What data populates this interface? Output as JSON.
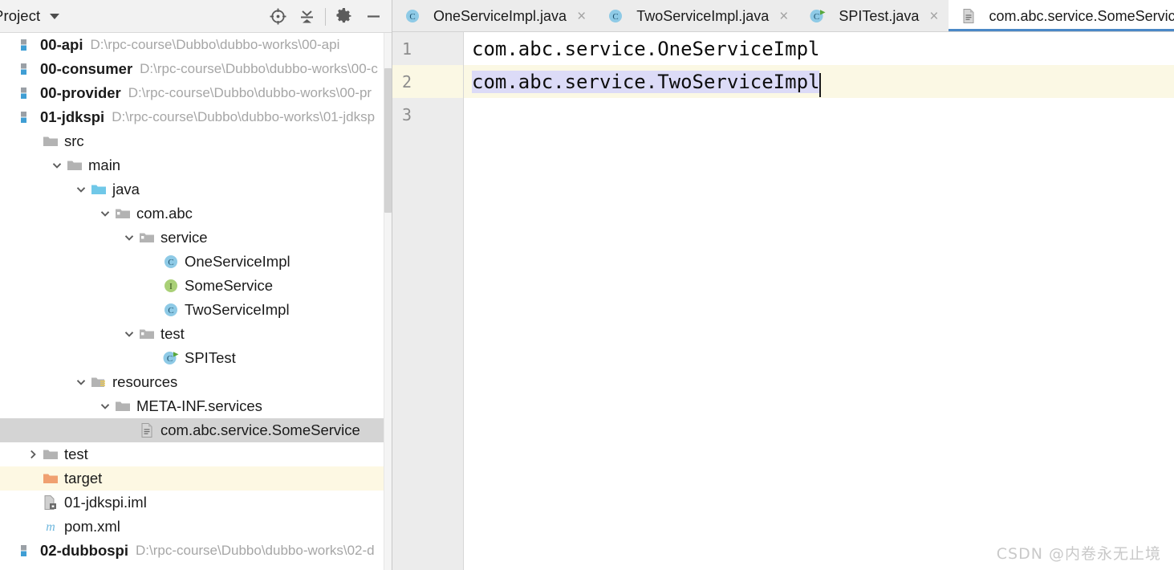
{
  "panel": {
    "title": "Project",
    "dropdown_icon": "chevron-down-icon",
    "toolbar_buttons": [
      {
        "name": "locate-file-icon",
        "title": "Select Opened File"
      },
      {
        "name": "collapse-all-icon",
        "title": "Collapse All"
      },
      {
        "name": "gear-icon",
        "title": "Settings"
      },
      {
        "name": "minimize-icon",
        "title": "Hide"
      }
    ]
  },
  "tree": [
    {
      "label": "00-api",
      "path": "D:\\rpc-course\\Dubbo\\dubbo-works\\00-api",
      "icon": "module-icon",
      "indent": 0,
      "arrow": "none",
      "bold": true,
      "state": "normal"
    },
    {
      "label": "00-consumer",
      "path": "D:\\rpc-course\\Dubbo\\dubbo-works\\00-c",
      "icon": "module-icon",
      "indent": 0,
      "arrow": "none",
      "bold": true,
      "state": "normal"
    },
    {
      "label": "00-provider",
      "path": "D:\\rpc-course\\Dubbo\\dubbo-works\\00-pr",
      "icon": "module-icon",
      "indent": 0,
      "arrow": "none",
      "bold": true,
      "state": "normal"
    },
    {
      "label": "01-jdkspi",
      "path": "D:\\rpc-course\\Dubbo\\dubbo-works\\01-jdksp",
      "icon": "module-icon",
      "indent": 0,
      "arrow": "none",
      "bold": true,
      "state": "normal"
    },
    {
      "label": "src",
      "path": "",
      "icon": "folder-icon",
      "indent": 1,
      "arrow": "none",
      "bold": false,
      "state": "normal"
    },
    {
      "label": "main",
      "path": "",
      "icon": "folder-icon",
      "indent": 2,
      "arrow": "expanded",
      "bold": false,
      "state": "normal"
    },
    {
      "label": "java",
      "path": "",
      "icon": "source-folder-icon",
      "indent": 3,
      "arrow": "expanded",
      "bold": false,
      "state": "normal"
    },
    {
      "label": "com.abc",
      "path": "",
      "icon": "package-icon",
      "indent": 4,
      "arrow": "expanded",
      "bold": false,
      "state": "normal"
    },
    {
      "label": "service",
      "path": "",
      "icon": "package-icon",
      "indent": 5,
      "arrow": "expanded",
      "bold": false,
      "state": "normal"
    },
    {
      "label": "OneServiceImpl",
      "path": "",
      "icon": "java-class-icon",
      "indent": 6,
      "arrow": "none",
      "bold": false,
      "state": "normal"
    },
    {
      "label": "SomeService",
      "path": "",
      "icon": "java-interface-icon",
      "indent": 6,
      "arrow": "none",
      "bold": false,
      "state": "normal"
    },
    {
      "label": "TwoServiceImpl",
      "path": "",
      "icon": "java-class-icon",
      "indent": 6,
      "arrow": "none",
      "bold": false,
      "state": "normal"
    },
    {
      "label": "test",
      "path": "",
      "icon": "package-icon",
      "indent": 5,
      "arrow": "expanded",
      "bold": false,
      "state": "normal"
    },
    {
      "label": "SPITest",
      "path": "",
      "icon": "java-test-class-icon",
      "indent": 6,
      "arrow": "none",
      "bold": false,
      "state": "normal"
    },
    {
      "label": "resources",
      "path": "",
      "icon": "resources-folder-icon",
      "indent": 3,
      "arrow": "expanded",
      "bold": false,
      "state": "normal"
    },
    {
      "label": "META-INF.services",
      "path": "",
      "icon": "folder-icon",
      "indent": 4,
      "arrow": "expanded",
      "bold": false,
      "state": "normal"
    },
    {
      "label": "com.abc.service.SomeService",
      "path": "",
      "icon": "text-file-icon",
      "indent": 5,
      "arrow": "none",
      "bold": false,
      "state": "selected"
    },
    {
      "label": "test",
      "path": "",
      "icon": "folder-icon",
      "indent": 1,
      "arrow": "collapsed",
      "bold": false,
      "state": "normal"
    },
    {
      "label": "target",
      "path": "",
      "icon": "excluded-folder-icon",
      "indent": 1,
      "arrow": "none",
      "bold": false,
      "state": "excluded"
    },
    {
      "label": "01-jdkspi.iml",
      "path": "",
      "icon": "iml-file-icon",
      "indent": 1,
      "arrow": "none",
      "bold": false,
      "state": "normal"
    },
    {
      "label": "pom.xml",
      "path": "",
      "icon": "maven-file-icon",
      "indent": 1,
      "arrow": "none",
      "bold": false,
      "state": "normal"
    },
    {
      "label": "02-dubbospi",
      "path": "D:\\rpc-course\\Dubbo\\dubbo-works\\02-d",
      "icon": "module-icon",
      "indent": 0,
      "arrow": "none",
      "bold": true,
      "state": "normal"
    }
  ],
  "tabs": [
    {
      "label": "OneServiceImpl.java",
      "icon": "java-class-icon",
      "active": false,
      "close": "×"
    },
    {
      "label": "TwoServiceImpl.java",
      "icon": "java-class-icon",
      "active": false,
      "close": "×"
    },
    {
      "label": "SPITest.java",
      "icon": "java-test-class-icon",
      "active": false,
      "close": "×"
    },
    {
      "label": "com.abc.service.SomeService",
      "icon": "text-file-icon",
      "active": true,
      "close": "×"
    }
  ],
  "editor": {
    "lines": [
      {
        "number": "1",
        "text": "com.abc.service.OneServiceImpl",
        "selected": false,
        "current": false
      },
      {
        "number": "2",
        "text": "com.abc.service.TwoServiceImpl",
        "selected": true,
        "current": true
      },
      {
        "number": "3",
        "text": "",
        "selected": false,
        "current": false
      }
    ]
  },
  "watermark": "CSDN @内卷永无止境",
  "colors": {
    "accent_tab_underline": "#4a88c7",
    "selection": "#dcdbf7",
    "current_line": "#fbf8e4",
    "tree_selected": "#d4d4d4",
    "excluded_folder": "#f0a070",
    "class_icon": "#89c9e8",
    "interface_icon": "#a5ce7f"
  }
}
